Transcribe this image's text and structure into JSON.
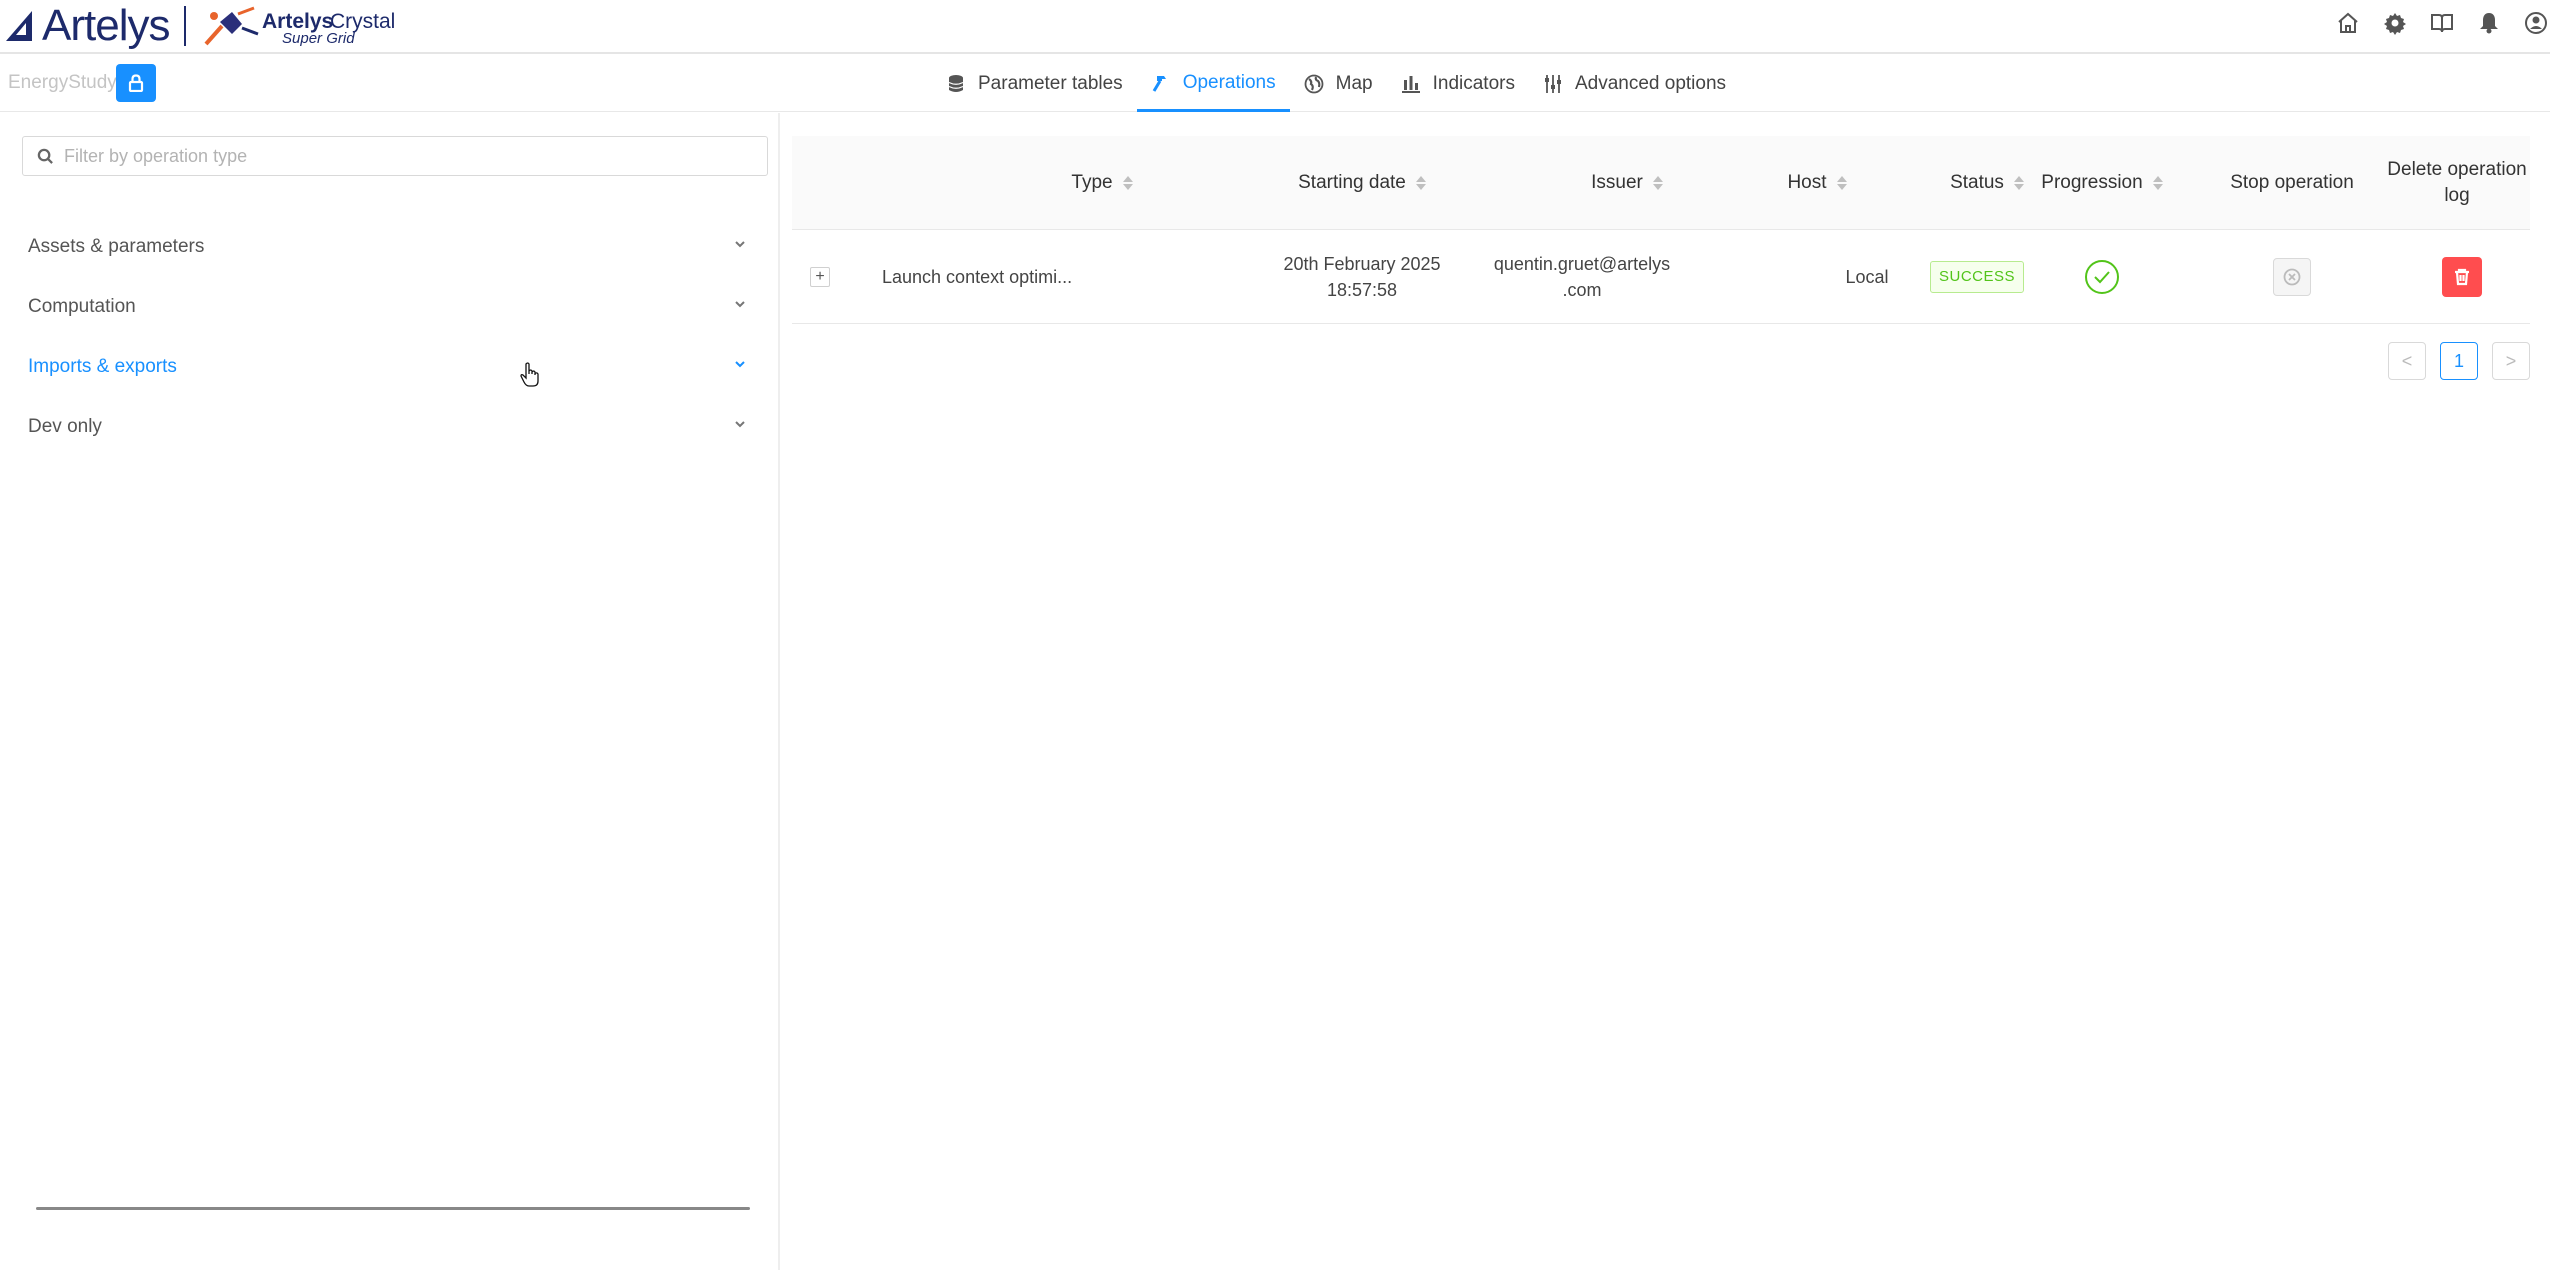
{
  "brand": {
    "name": "Artelys",
    "product_bold": "Artelys",
    "product_light": "Crystal",
    "product_sub": "Super Grid"
  },
  "header_icons": [
    "home-icon",
    "gear-icon",
    "book-icon",
    "bell-icon",
    "user-icon"
  ],
  "study": {
    "name": "EnergyStudy"
  },
  "tabs": [
    {
      "label": "Parameter tables",
      "icon": "database-icon"
    },
    {
      "label": "Operations",
      "icon": "hammer-icon",
      "active": true
    },
    {
      "label": "Map",
      "icon": "globe-icon"
    },
    {
      "label": "Indicators",
      "icon": "bar-chart-icon"
    },
    {
      "label": "Advanced options",
      "icon": "sliders-icon"
    }
  ],
  "filter": {
    "placeholder": "Filter by operation type",
    "value": ""
  },
  "categories": [
    {
      "label": "Assets & parameters"
    },
    {
      "label": "Computation"
    },
    {
      "label": "Imports & exports",
      "active": true
    },
    {
      "label": "Dev only"
    }
  ],
  "table": {
    "columns": {
      "type": "Type",
      "start": "Starting date",
      "issuer": "Issuer",
      "host": "Host",
      "status": "Status",
      "progression": "Progression",
      "stop": "Stop operation",
      "delete_line1": "Delete operation",
      "delete_line2": "log"
    },
    "rows": [
      {
        "type": "Launch context optimi...",
        "start_line1": "20th February 2025",
        "start_line2": "18:57:58",
        "issuer_line1": "quentin.gruet@artelys",
        "issuer_line2": ".com",
        "host": "Local",
        "status": "SUCCESS",
        "expand": "+"
      }
    ]
  },
  "pagination": {
    "prev": "<",
    "current": "1",
    "next": ">"
  },
  "colors": {
    "accent": "#1890ff",
    "danger": "#ff4d4f",
    "success": "#52c41a",
    "brand": "#1d2a6b"
  }
}
